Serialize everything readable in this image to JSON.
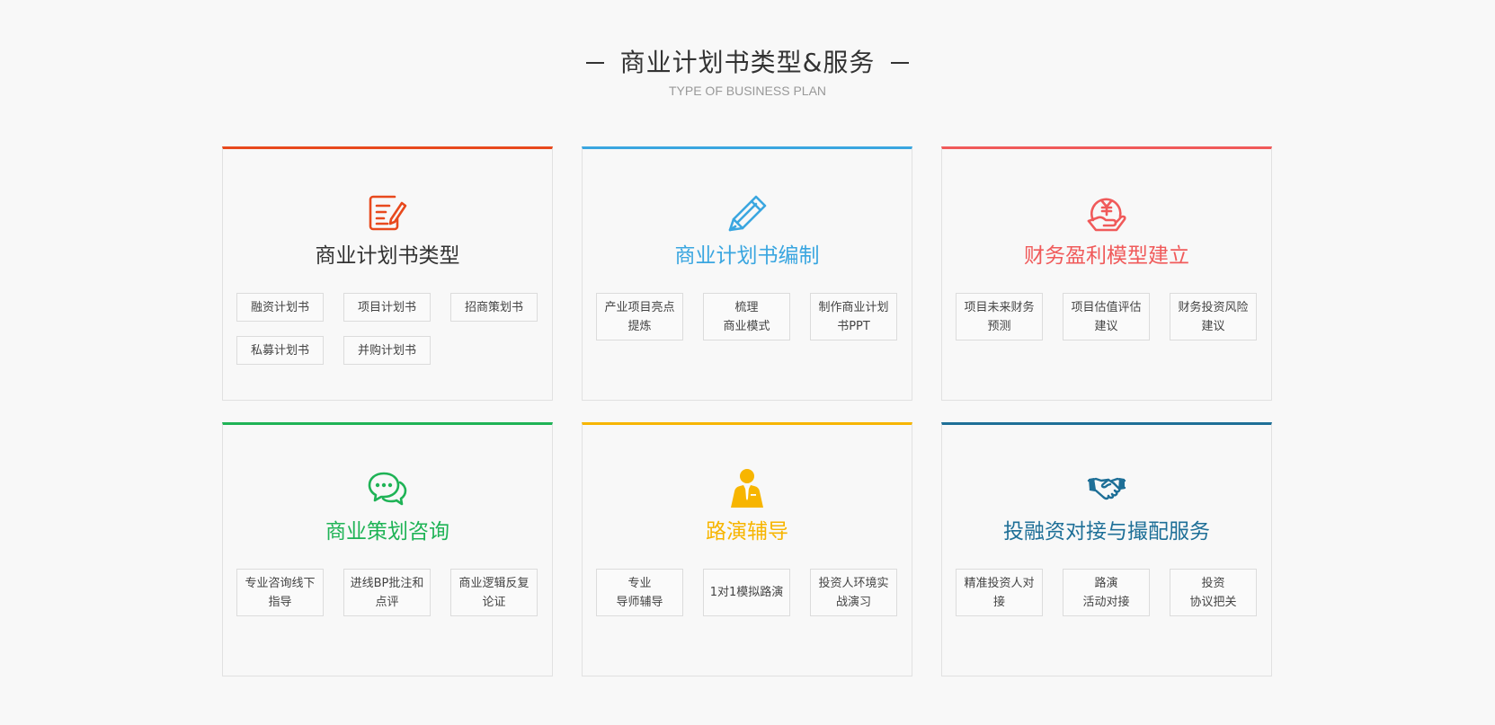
{
  "header": {
    "title": "商业计划书类型&服务",
    "subtitle": "TYPE OF BUSINESS PLAN"
  },
  "cards": [
    {
      "title": "商业计划书类型",
      "accent": "#e8491d",
      "title_color": "#333333",
      "icon": "document-edit-icon",
      "tags": [
        "融资计划书",
        "项目计划书",
        "招商策划书",
        "私募计划书",
        "并购计划书"
      ]
    },
    {
      "title": "商业计划书编制",
      "accent": "#3aa6e0",
      "title_color": "#3aa6e0",
      "icon": "pencil-icon",
      "tags": [
        "产业项目亮点提炼",
        "梳理\n商业模式",
        "制作商业计划书PPT"
      ]
    },
    {
      "title": "财务盈利模型建立",
      "accent": "#f05a5a",
      "title_color": "#f05a5a",
      "icon": "yuen-coin-hand-icon",
      "tags": [
        "项目未来财务预测",
        "项目估值评估建议",
        "财务投资风险建议"
      ]
    },
    {
      "title": "商业策划咨询",
      "accent": "#1fb356",
      "title_color": "#1fb356",
      "icon": "chat-bubble-icon",
      "tags": [
        "专业咨询线下指导",
        "进线BP批注和点评",
        "商业逻辑反复论证"
      ]
    },
    {
      "title": "路演辅导",
      "accent": "#f7b500",
      "title_color": "#f7b500",
      "icon": "presenter-icon",
      "tags": [
        "专业\n导师辅导",
        "1对1模拟路演",
        "投资人环境实战演习"
      ]
    },
    {
      "title": "投融资对接与撮配服务",
      "accent": "#1e6f97",
      "title_color": "#1e6f97",
      "icon": "handshake-icon",
      "tags": [
        "精准投资人对接",
        "路演\n活动对接",
        "投资\n协议把关"
      ]
    }
  ]
}
